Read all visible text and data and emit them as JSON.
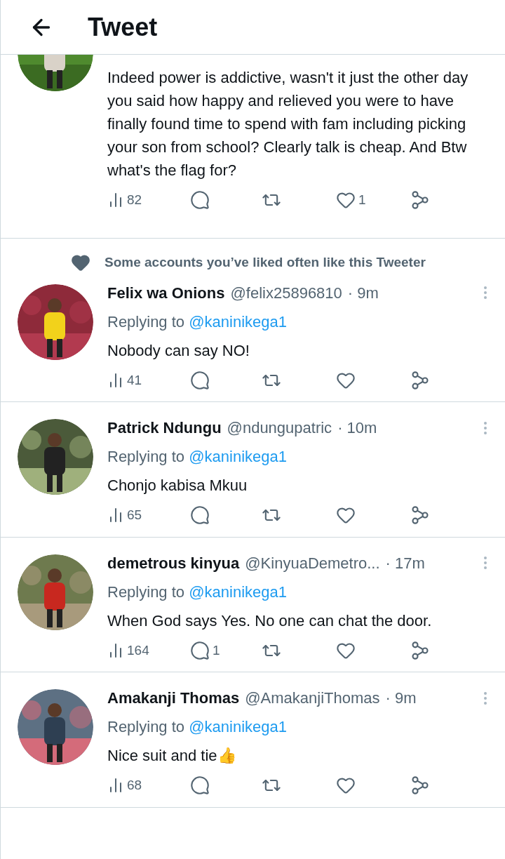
{
  "header": {
    "title": "Tweet"
  },
  "partial_tweet": {
    "text": "Indeed power is addictive, wasn't it just the other day you said how happy and relieved you were to have finally found time to spend with fam including picking your son from school? Clearly talk is cheap. And Btw what's the flag for?",
    "stats": {
      "views": "82",
      "likes": "1"
    }
  },
  "tweets": [
    {
      "social_context": "Some accounts you’ve liked often like this Tweeter",
      "name": "Felix wa Onions",
      "handle": "@felix25896810",
      "time": "· 9m",
      "replying_label": "Replying to",
      "replying_handle": "@kaninikega1",
      "text": "Nobody can say NO!",
      "stats": {
        "views": "41"
      }
    },
    {
      "name": "Patrick Ndungu",
      "handle": "@ndungupatric",
      "time": "· 10m",
      "replying_label": "Replying to",
      "replying_handle": "@kaninikega1",
      "text": "Chonjo kabisa Mkuu",
      "stats": {
        "views": "65"
      }
    },
    {
      "name": "demetrous kinyua",
      "handle": "@KinyuaDemetro...",
      "time": "· 17m",
      "replying_label": "Replying to",
      "replying_handle": "@kaninikega1",
      "text": "When God says Yes. No one can chat the door.",
      "stats": {
        "views": "164",
        "replies": "1"
      }
    },
    {
      "name": "Amakanji Thomas",
      "handle": "@AmakanjiThomas",
      "time": "· 9m",
      "replying_label": "Replying to",
      "replying_handle": "@kaninikega1",
      "text": "Nice suit and tie👍",
      "stats": {
        "views": "68"
      }
    }
  ]
}
